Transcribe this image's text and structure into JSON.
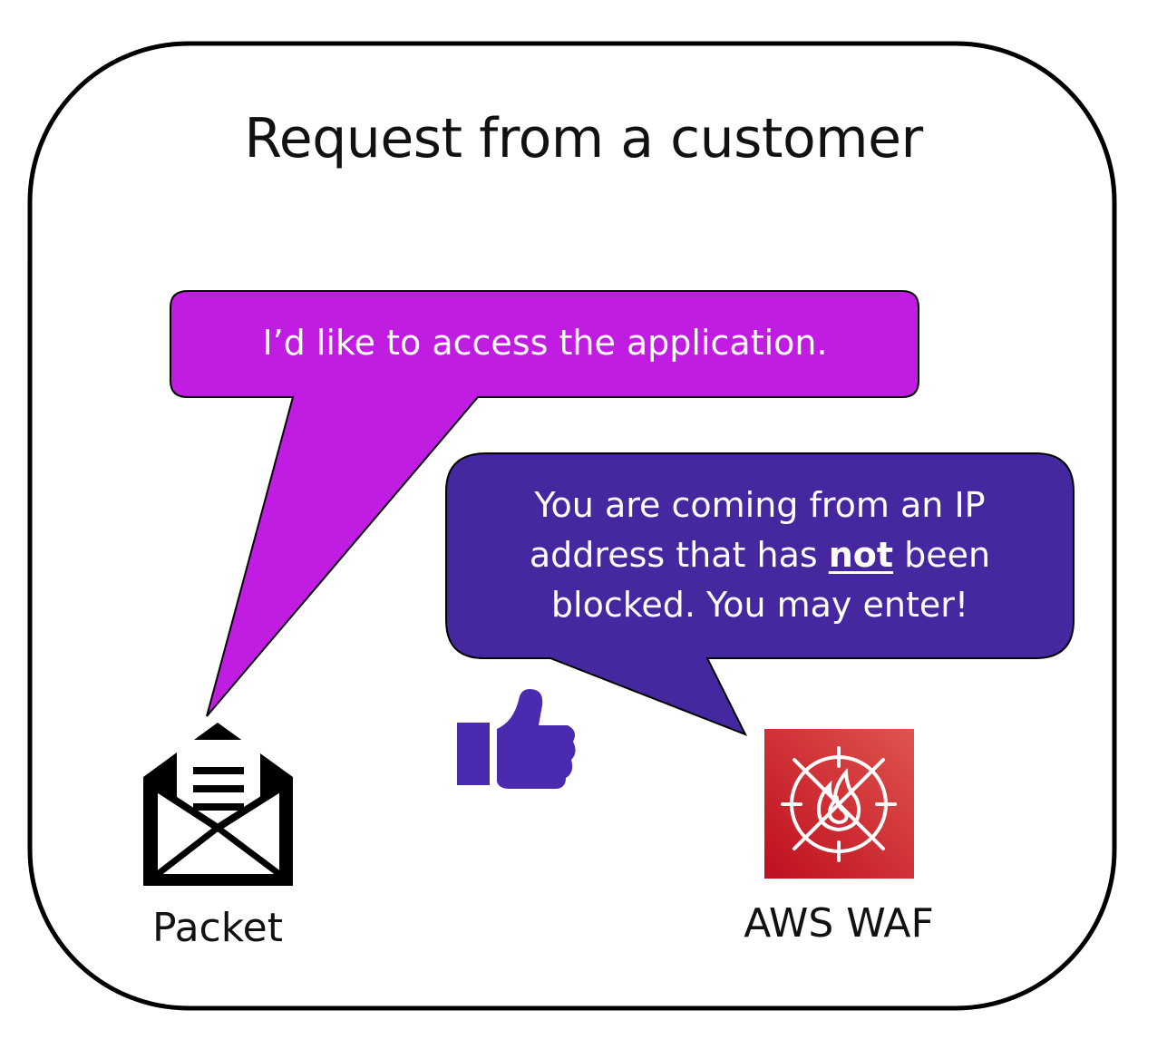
{
  "diagram": {
    "title": "Request from a customer",
    "request_bubble": {
      "text": "I’d like to access the application."
    },
    "reply_bubble": {
      "line1": "You are coming from an IP",
      "line2_before": "address that has ",
      "line2_emphasis": "not",
      "line2_after": " been",
      "line3": "blocked. You may enter!"
    },
    "packet": {
      "label": "Packet",
      "icon": "open-envelope-icon"
    },
    "waf": {
      "label": "AWS WAF",
      "icon": "aws-waf-icon"
    },
    "approval": {
      "icon": "thumbs-up-icon"
    },
    "colors": {
      "request_bubble": "#C11CE2",
      "reply_bubble": "#4527A0",
      "thumbs_up": "#4A2BB0",
      "waf_gradient_start": "#BE0F1E",
      "waf_gradient_end": "#E0544E",
      "outline": "#000000"
    }
  }
}
